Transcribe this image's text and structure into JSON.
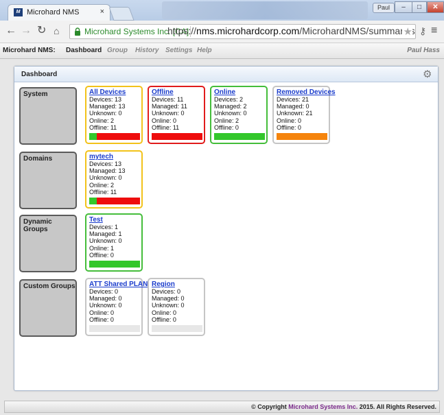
{
  "browser": {
    "tab_title": "Microhard NMS",
    "tab_close": "×",
    "user_badge": "Paul",
    "secure_label": "Microhard Systems Inc. [CA]",
    "url_scheme": "https://",
    "url_host": "nms.microhardcorp.com",
    "url_path": "/MicrohardNMS/summary.seam"
  },
  "appnav": {
    "brand": "Microhard NMS:",
    "items": [
      "Dashboard",
      "Group",
      "History",
      "Settings",
      "Help"
    ],
    "user": "Paul Hass"
  },
  "dashboard": {
    "title": "Dashboard",
    "categories": [
      {
        "label": "System",
        "cards": [
          {
            "title": "All Devices",
            "devices": "Devices: 13",
            "managed": "Managed: 13",
            "unknown": "Unknown: 0",
            "online": "Online: 2",
            "offline": "Offline: 11",
            "border": "#f2c21a",
            "online_frac": 0.154,
            "offline_frac": 0.846,
            "unknown_frac": 0
          },
          {
            "title": "Offline",
            "devices": "Devices: 11",
            "managed": "Managed: 11",
            "unknown": "Unknown: 0",
            "online": "Online: 0",
            "offline": "Offline: 11",
            "border": "#e11b1b",
            "online_frac": 0,
            "offline_frac": 1,
            "unknown_frac": 0
          },
          {
            "title": "Online",
            "devices": "Devices: 2",
            "managed": "Managed: 2",
            "unknown": "Unknown: 0",
            "online": "Online: 2",
            "offline": "Offline: 0",
            "border": "#44bd3a",
            "online_frac": 1,
            "offline_frac": 0,
            "unknown_frac": 0
          },
          {
            "title": "Removed Devices",
            "devices": "Devices: 21",
            "managed": "Managed: 0",
            "unknown": "Unknown: 21",
            "online": "Online: 0",
            "offline": "Offline: 0",
            "border": "#c5c5c5",
            "online_frac": 0,
            "offline_frac": 0,
            "unknown_frac": 1
          }
        ]
      },
      {
        "label": "Domains",
        "cards": [
          {
            "title": "mytech",
            "devices": "Devices: 13",
            "managed": "Managed: 13",
            "unknown": "Unknown: 0",
            "online": "Online: 2",
            "offline": "Offline: 11",
            "border": "#f2c21a",
            "online_frac": 0.154,
            "offline_frac": 0.846,
            "unknown_frac": 0
          }
        ]
      },
      {
        "label": "Dynamic Groups",
        "cards": [
          {
            "title": "Test",
            "devices": "Devices: 1",
            "managed": "Managed: 1",
            "unknown": "Unknown: 0",
            "online": "Online: 1",
            "offline": "Offline: 0",
            "border": "#44bd3a",
            "online_frac": 1,
            "offline_frac": 0,
            "unknown_frac": 0
          }
        ]
      },
      {
        "label": "Custom Groups",
        "cards": [
          {
            "title": "ATT Shared PLAN",
            "devices": "Devices: 0",
            "managed": "Managed: 0",
            "unknown": "Unknown: 0",
            "online": "Online: 0",
            "offline": "Offline: 0",
            "border": "#c5c5c5",
            "online_frac": 0,
            "offline_frac": 0,
            "unknown_frac": 0
          },
          {
            "title": "Region",
            "devices": "Devices: 0",
            "managed": "Managed: 0",
            "unknown": "Unknown: 0",
            "online": "Online: 0",
            "offline": "Offline: 0",
            "border": "#c5c5c5",
            "online_frac": 0,
            "offline_frac": 0,
            "unknown_frac": 0
          }
        ]
      }
    ]
  },
  "colors": {
    "online": "#33c72b",
    "offline": "#ee0d0d",
    "unknown": "#f5840c",
    "empty": "#e7e7e7"
  },
  "footer": {
    "prefix": "© Copyright ",
    "company": "Microhard Systems Inc.",
    "suffix": " 2015. All Rights Reserved."
  }
}
